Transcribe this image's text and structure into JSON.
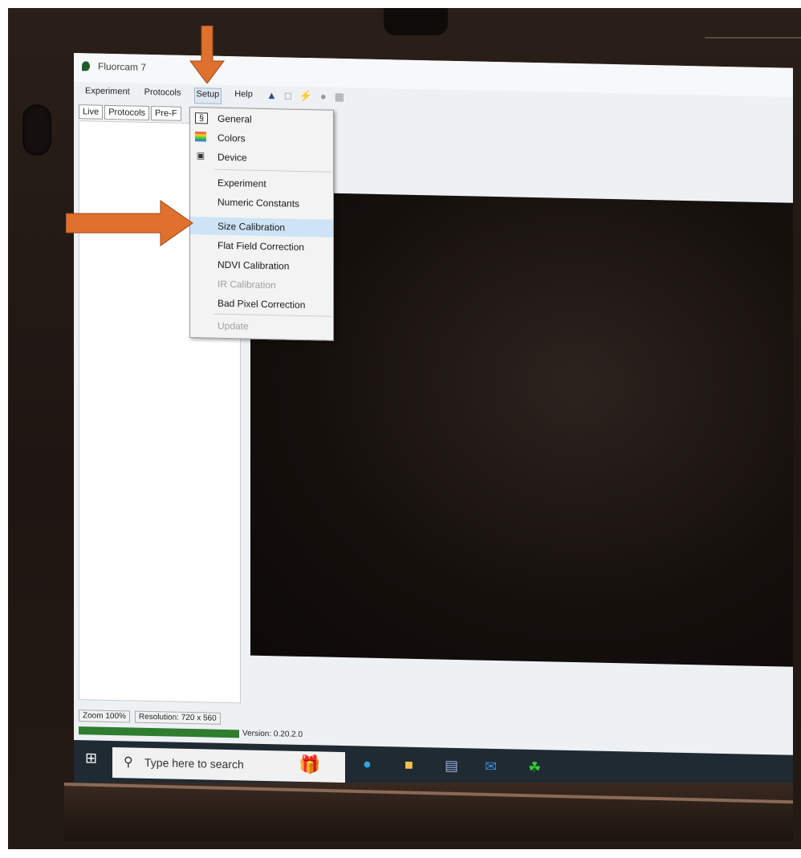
{
  "window": {
    "title": "Fluorcam 7"
  },
  "menubar": [
    {
      "label": "Experiment"
    },
    {
      "label": "Protocols"
    },
    {
      "label": "Setup"
    },
    {
      "label": "Help"
    }
  ],
  "tabs": [
    {
      "label": "Live"
    },
    {
      "label": "Protocols"
    },
    {
      "label": "Pre-F"
    }
  ],
  "setup_menu": {
    "items": [
      {
        "label": "General",
        "icon": "general-icon"
      },
      {
        "label": "Colors",
        "icon": "colors-icon"
      },
      {
        "label": "Device",
        "icon": "device-icon"
      },
      {
        "label": "Experiment"
      },
      {
        "label": "Numeric Constants"
      },
      {
        "label": "Size Calibration",
        "highlighted": true
      },
      {
        "label": "Flat Field Correction"
      },
      {
        "label": "NDVI Calibration"
      },
      {
        "label": "IR Calibration",
        "disabled": true
      },
      {
        "label": "Bad Pixel Correction"
      },
      {
        "label": "Update",
        "disabled": true
      }
    ]
  },
  "statusbar": {
    "zoom": "Zoom 100%",
    "resolution": "Resolution: 720 x 560",
    "version": "Version: 0.20.2.0"
  },
  "taskbar": {
    "search_placeholder": "Type here to search"
  },
  "colors": {
    "arrow": "#e0702e",
    "highlight": "#cfe3f7",
    "status_green": "#2f7d2f"
  }
}
